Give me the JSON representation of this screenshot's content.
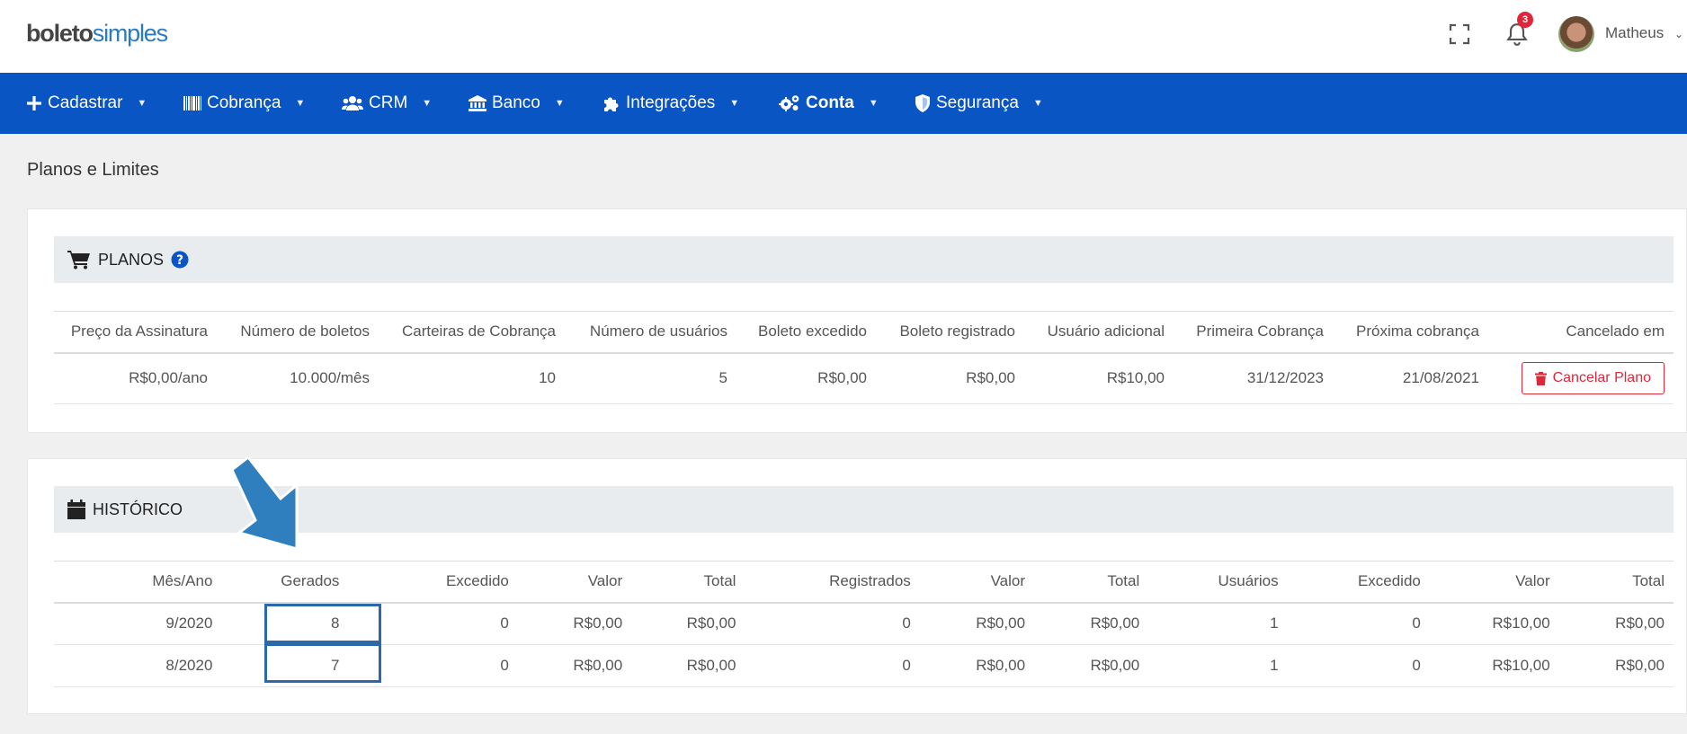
{
  "header": {
    "logo_part1": "boleto",
    "logo_part2": "simples",
    "notifications_count": "3",
    "user_name": "Matheus"
  },
  "nav": {
    "items": [
      {
        "label": "Cadastrar",
        "icon": "plus-icon"
      },
      {
        "label": "Cobrança",
        "icon": "barcode-icon"
      },
      {
        "label": "CRM",
        "icon": "users-icon"
      },
      {
        "label": "Banco",
        "icon": "bank-icon"
      },
      {
        "label": "Integrações",
        "icon": "puzzle-icon"
      },
      {
        "label": "Conta",
        "icon": "gears-icon"
      },
      {
        "label": "Segurança",
        "icon": "shield-icon"
      }
    ],
    "active": "Conta"
  },
  "page": {
    "title": "Planos e Limites"
  },
  "plans": {
    "title": "PLANOS",
    "columns": [
      "Preço da Assinatura",
      "Número de boletos",
      "Carteiras de Cobrança",
      "Número de usuários",
      "Boleto excedido",
      "Boleto registrado",
      "Usuário adicional",
      "Primeira Cobrança",
      "Próxima cobrança",
      "Cancelado em"
    ],
    "row": [
      "R$0,00/ano",
      "10.000/mês",
      "10",
      "5",
      "R$0,00",
      "R$0,00",
      "R$10,00",
      "31/12/2023",
      "21/08/2021"
    ],
    "cancel_label": "Cancelar Plano"
  },
  "history": {
    "title": "HISTÓRICO",
    "columns": [
      "Mês/Ano",
      "Gerados",
      "Excedido",
      "Valor",
      "Total",
      "Registrados",
      "Valor",
      "Total",
      "Usuários",
      "Excedido",
      "Valor",
      "Total"
    ],
    "rows": [
      [
        "9/2020",
        "8",
        "0",
        "R$0,00",
        "R$0,00",
        "0",
        "R$0,00",
        "R$0,00",
        "1",
        "0",
        "R$10,00",
        "R$0,00"
      ],
      [
        "8/2020",
        "7",
        "0",
        "R$0,00",
        "R$0,00",
        "0",
        "R$0,00",
        "R$0,00",
        "1",
        "0",
        "R$10,00",
        "R$0,00"
      ]
    ],
    "highlighted_column": "Gerados"
  },
  "colors": {
    "nav_bg": "#0a55c4",
    "danger": "#e0273a",
    "highlight": "#2a6aa8",
    "arrow": "#2f7fbf"
  }
}
